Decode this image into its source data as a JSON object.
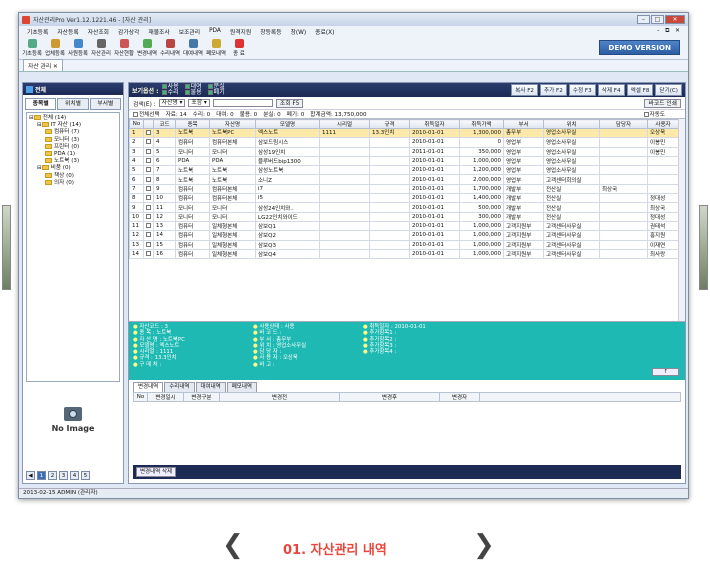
{
  "window": {
    "title": "자산관리Pro Ver1.12.1221.46 - [자산 관리]"
  },
  "menu": [
    "기초등록",
    "자산등록",
    "자산조회",
    "감가상각",
    "재물조사",
    "보조관리",
    "PDA",
    "원격지원",
    "창등록등",
    "창(W)",
    "종료(X)"
  ],
  "toolbar": [
    {
      "label": "기초등록",
      "color": "#5a8"
    },
    {
      "label": "업체등록",
      "color": "#c93"
    },
    {
      "label": "사원등록",
      "color": "#48c"
    },
    {
      "label": "자산관리",
      "color": "#666"
    },
    {
      "label": "자산현황",
      "color": "#c55"
    },
    {
      "label": "변경내역",
      "color": "#5a5"
    },
    {
      "label": "수리내역",
      "color": "#b44"
    },
    {
      "label": "대여내역",
      "color": "#47a"
    },
    {
      "label": "폐모내역",
      "color": "#ca3"
    },
    {
      "label": "종 료",
      "color": "#d33"
    }
  ],
  "demo_label": "DEMO VERSION",
  "doc_tab": "자산 관리",
  "left": {
    "header": "전체",
    "tabs": [
      "종목별",
      "위치별",
      "부서별"
    ],
    "tree": [
      {
        "t": "전체 (14)",
        "lv": 0
      },
      {
        "t": "IT 자산 (14)",
        "lv": 1
      },
      {
        "t": "컴퓨터 (7)",
        "lv": 2
      },
      {
        "t": "모니터 (3)",
        "lv": 2
      },
      {
        "t": "프린터 (0)",
        "lv": 2
      },
      {
        "t": "PDA (1)",
        "lv": 2
      },
      {
        "t": "노트북 (3)",
        "lv": 2
      },
      {
        "t": "비품 (0)",
        "lv": 1
      },
      {
        "t": "책상 (0)",
        "lv": 2
      },
      {
        "t": "의자 (0)",
        "lv": 2
      }
    ],
    "no_image": "No Image",
    "pages": [
      "1",
      "2",
      "3",
      "4",
      "5"
    ]
  },
  "main": {
    "cond_label": "보기옵션 :",
    "conds": [
      "사용",
      "대여",
      "분실",
      "수리",
      "불용",
      "폐기"
    ],
    "actions": [
      "복사 F2",
      "추가 F2",
      "수정 F3",
      "삭제 F4",
      "엑셀 F8",
      "닫기(C)"
    ],
    "search_label": "검색(E) :",
    "search_field": "자산명",
    "search_op": "포함",
    "search_btn": "조회 F5",
    "barcode_btn": "바코드 인쇄",
    "summary": [
      "전체선택",
      "자료: 14",
      "수리: 0",
      "대여: 0",
      "불용: 0",
      "분실: 0",
      "폐기: 0",
      "합계금액: 13,750,000"
    ],
    "auto_label": "자동도",
    "columns": [
      "No",
      "",
      "코드",
      "종목",
      "자산명",
      "모델명",
      "시리얼",
      "규격",
      "취득일자",
      "취득가액",
      "부서",
      "위치",
      "담당자",
      "사용자"
    ],
    "rows": [
      [
        "1",
        "",
        "3",
        "노트북",
        "노트북PC",
        "엑스노트",
        "1111",
        "13.3인치",
        "2010-01-01",
        "1,300,000",
        "총무부",
        "영업소사무실",
        "",
        "오상욱"
      ],
      [
        "2",
        "",
        "4",
        "컴퓨터",
        "컴퓨터본체",
        "삼보드림시스",
        "",
        "",
        "2010-01-01",
        "0",
        "영업부",
        "영업소사무실",
        "",
        "이봉민"
      ],
      [
        "3",
        "",
        "5",
        "모니터",
        "모니터",
        "삼성19인치",
        "",
        "",
        "2011-01-01",
        "350,000",
        "영업부",
        "영업소사무실",
        "",
        "이봉민"
      ],
      [
        "4",
        "",
        "6",
        "PDA",
        "PDA",
        "블루버드bip1300",
        "",
        "",
        "2010-01-01",
        "1,000,000",
        "영업부",
        "영업소사무실",
        "",
        ""
      ],
      [
        "5",
        "",
        "7",
        "노트북",
        "노트북",
        "삼성노트북",
        "",
        "",
        "2010-01-01",
        "1,200,000",
        "영업부",
        "영업소사무실",
        "",
        ""
      ],
      [
        "6",
        "",
        "8",
        "노트북",
        "노트북",
        "소니Z",
        "",
        "",
        "2010-01-01",
        "2,000,000",
        "영업부",
        "고객센터회의실",
        "",
        ""
      ],
      [
        "7",
        "",
        "9",
        "컴퓨터",
        "컴퓨터본체",
        "i7",
        "",
        "",
        "2010-01-01",
        "1,700,000",
        "개발부",
        "전산실",
        "최상국",
        ""
      ],
      [
        "8",
        "",
        "10",
        "컴퓨터",
        "컴퓨터본체",
        "i5",
        "",
        "",
        "2010-01-01",
        "1,400,000",
        "개발부",
        "전산실",
        "",
        "정대성"
      ],
      [
        "9",
        "",
        "11",
        "모니터",
        "모니터",
        "삼성24인치와..",
        "",
        "",
        "2010-01-01",
        "500,000",
        "개발부",
        "전산실",
        "",
        "최상국"
      ],
      [
        "10",
        "",
        "12",
        "모니터",
        "모니터",
        "LG22인치와이드",
        "",
        "",
        "2010-01-01",
        "300,000",
        "개발부",
        "전산실",
        "",
        "정대성"
      ],
      [
        "11",
        "",
        "13",
        "컴퓨터",
        "일체형본체",
        "삼보Q1",
        "",
        "",
        "2010-01-01",
        "1,000,000",
        "고객지원부",
        "고객센터사무실",
        "",
        "권태석"
      ],
      [
        "12",
        "",
        "14",
        "컴퓨터",
        "일체형본체",
        "삼보Q2",
        "",
        "",
        "2010-01-01",
        "1,000,000",
        "고객지원부",
        "고객센터사무실",
        "",
        "홍지원"
      ],
      [
        "13",
        "",
        "15",
        "컴퓨터",
        "일체형본체",
        "삼보Q3",
        "",
        "",
        "2010-01-01",
        "1,000,000",
        "고객지원부",
        "고객센터사무실",
        "",
        "이재연"
      ],
      [
        "14",
        "",
        "16",
        "컴퓨터",
        "일체형본체",
        "삼보Q4",
        "",
        "",
        "2010-01-01",
        "1,000,000",
        "고객지원부",
        "고객센터사무실",
        "",
        "최사랑"
      ]
    ],
    "detail": [
      [
        "자산코드 : 3",
        "종    목 : 노트북",
        "자 산 명 : 노트북PC",
        "모델명 : 엑스노트",
        "시리얼 : 1111",
        "규격 :  13.3인치",
        "구 매 처 :"
      ],
      [
        "사용상태 : 사용",
        "바 코 드 :",
        "부    서 : 총무부",
        "위    치 : 영업소사무실",
        "담 당 자 :",
        "사 용 자 : 오상욱",
        "비    고 :"
      ],
      [
        "취득일자 : 2010-01-01",
        "추가항목1 :",
        "추가항목2 :",
        "추가항목3 :",
        "추가항목4 :"
      ]
    ],
    "up_btn": "↑",
    "bottom_tabs": [
      "변경내역",
      "수리내역",
      "대여내역",
      "폐모내역"
    ],
    "bottom_cols": [
      "No",
      "변경일시",
      "변경구분",
      "변경전",
      "변경후",
      "변경자"
    ],
    "bottom_btn": "변경내역 삭제"
  },
  "status": "2013-02-15   ADMIN (관리자)",
  "caption": "01. 자산관리 내역"
}
